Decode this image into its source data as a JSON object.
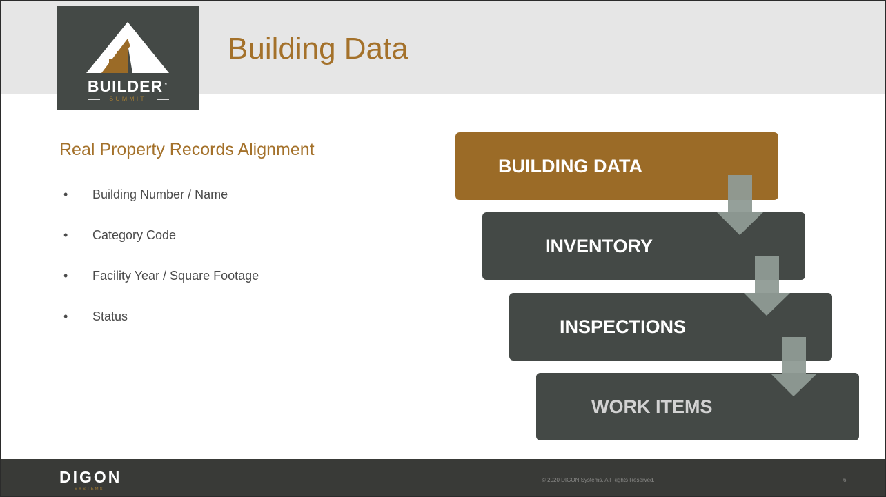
{
  "header": {
    "title": "Building Data",
    "logo_name": "BUILDER",
    "logo_sub": "SUMMIT",
    "logo_mark": "™"
  },
  "main": {
    "heading": "Real Property Records Alignment",
    "bullets": [
      "Building Number / Name",
      "Category Code",
      "Facility Year / Square Footage",
      "Status"
    ],
    "bullet_char": "•"
  },
  "flow": {
    "steps": [
      "BUILDING DATA",
      "INVENTORY",
      "INSPECTIONS",
      "WORK ITEMS"
    ]
  },
  "footer": {
    "brand": "DIGON",
    "brand_sub": "SYSTEMS",
    "copyright": "© 2020 DIGON Systems.  All Rights Reserved.",
    "page_number": "6"
  },
  "colors": {
    "accent_brown": "#9b6b27",
    "dark_gray": "#444946",
    "header_band": "#e6e6e6",
    "footer": "#393a37",
    "arrow": "#8f9b95"
  }
}
